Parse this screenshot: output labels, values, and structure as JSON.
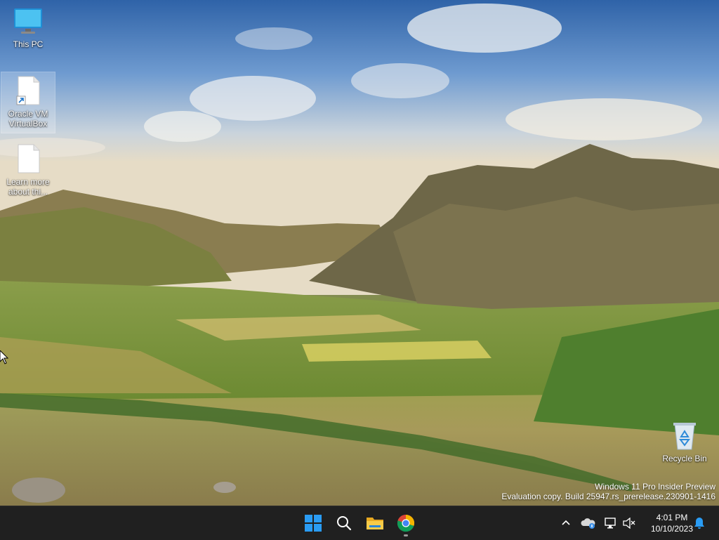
{
  "desktop": {
    "icons": [
      {
        "label": "This PC",
        "icon": "monitor-icon"
      },
      {
        "label": "Oracle VM VirtualBox",
        "icon": "shortcut-file-icon"
      },
      {
        "label": "Learn more about thi...",
        "icon": "file-icon"
      },
      {
        "label": "Recycle Bin",
        "icon": "recycle-bin-icon"
      }
    ],
    "watermark": {
      "line1": "Windows 11 Pro Insider Preview",
      "line2": "Evaluation copy. Build 25947.rs_prerelease.230901-1416"
    }
  },
  "taskbar": {
    "pinned": [
      {
        "name": "Start",
        "icon": "windows-logo-icon"
      },
      {
        "name": "Search",
        "icon": "search-icon"
      },
      {
        "name": "File Explorer",
        "icon": "folder-icon"
      },
      {
        "name": "Google Chrome",
        "icon": "chrome-icon",
        "running": true
      }
    ],
    "tray": {
      "icons": [
        "chevron-up-icon",
        "onedrive-icon",
        "network-icon",
        "volume-muted-icon"
      ],
      "time": "4:01 PM",
      "date": "10/10/2023",
      "notification_icon": "bell-icon"
    }
  },
  "colors": {
    "taskbar": "#202020",
    "windows_blue": "#0078d4",
    "folder_yellow": "#f4c542"
  }
}
